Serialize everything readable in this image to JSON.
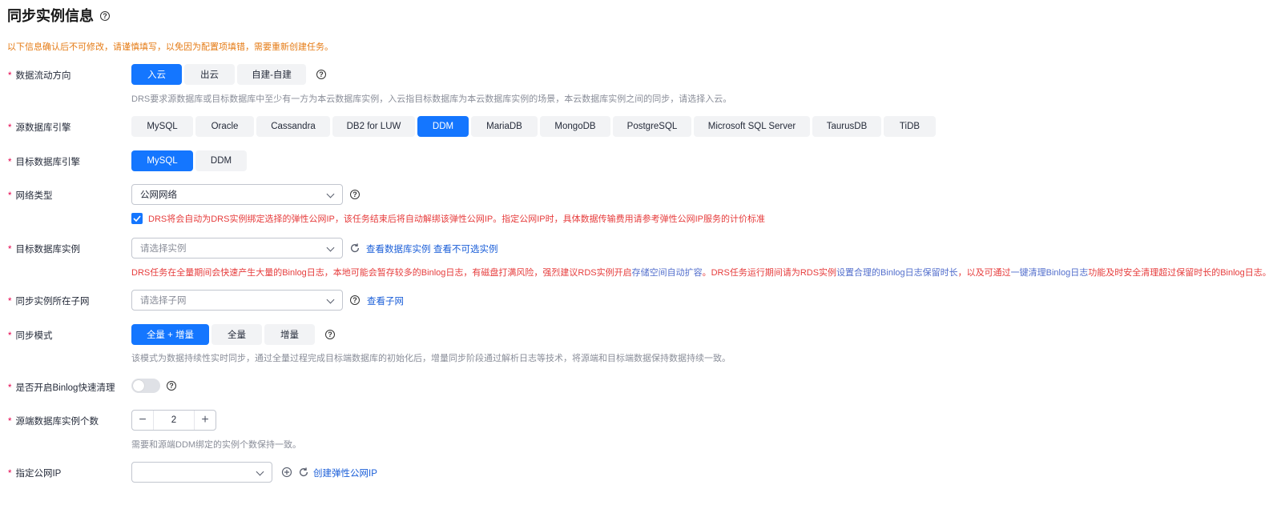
{
  "page": {
    "title": "同步实例信息",
    "notice": "以下信息确认后不可修改，请谨慎填写，以免因为配置项填错，需要重新创建任务。"
  },
  "required_mark": "*",
  "help_glyph": "?",
  "flow_direction": {
    "label": "数据流动方向",
    "options": [
      "入云",
      "出云",
      "自建-自建"
    ],
    "selected": "入云",
    "hint": "DRS要求源数据库或目标数据库中至少有一方为本云数据库实例，入云指目标数据库为本云数据库实例的场景，本云数据库实例之间的同步，请选择入云。"
  },
  "source_engine": {
    "label": "源数据库引擎",
    "options": [
      "MySQL",
      "Oracle",
      "Cassandra",
      "DB2 for LUW",
      "DDM",
      "MariaDB",
      "MongoDB",
      "PostgreSQL",
      "Microsoft SQL Server",
      "TaurusDB",
      "TiDB"
    ],
    "selected": "DDM"
  },
  "target_engine": {
    "label": "目标数据库引擎",
    "options": [
      "MySQL",
      "DDM"
    ],
    "selected": "MySQL"
  },
  "network_type": {
    "label": "网络类型",
    "value": "公网网络",
    "checkbox_checked": true,
    "checkbox_text": "DRS将会自动为DRS实例绑定选择的弹性公网IP，该任务结束后将自动解绑该弹性公网IP。指定公网IP时，具体数据传输费用请参考弹性公网IP服务的计价标准"
  },
  "target_instance": {
    "label": "目标数据库实例",
    "placeholder": "请选择实例",
    "link_view": "查看数据库实例",
    "link_unavailable": "查看不可选实例",
    "warning": {
      "part1": "DRS任务在全量期间会快速产生大量的Binlog日志，本地可能会暂存较多的Binlog日志，有磁盘打满风险，强烈建议RDS实例开启",
      "link1": "存储空间自动扩容",
      "part2": "。DRS任务运行期间请为RDS实例",
      "link2": "设置合理的Binlog日志保留时长",
      "part3": "，以及可通过",
      "link3": "一键清理Binlog日志",
      "part4": "功能及时安全清理超过保留时长的Binlog日志。"
    }
  },
  "subnet": {
    "label": "同步实例所在子网",
    "placeholder": "请选择子网",
    "link": "查看子网"
  },
  "sync_mode": {
    "label": "同步模式",
    "options": [
      "全量 + 增量",
      "全量",
      "增量"
    ],
    "selected": "全量 + 增量",
    "hint": "该模式为数据持续性实时同步，通过全量过程完成目标端数据库的初始化后，增量同步阶段通过解析日志等技术，将源端和目标端数据保持数据持续一致。"
  },
  "binlog_cleanup": {
    "label": "是否开启Binlog快速清理",
    "enabled": false
  },
  "source_instance_count": {
    "label": "源端数据库实例个数",
    "value": "2",
    "minus": "−",
    "plus": "+",
    "hint": "需要和源端DDM绑定的实例个数保持一致。"
  },
  "public_ip": {
    "label": "指定公网IP",
    "value": "",
    "link": "创建弹性公网IP"
  },
  "colors": {
    "primary": "#1476ff",
    "required": "#e5004c",
    "notice": "#e57b15",
    "warning": "#e63c3c",
    "link": "#1a5ed8"
  }
}
